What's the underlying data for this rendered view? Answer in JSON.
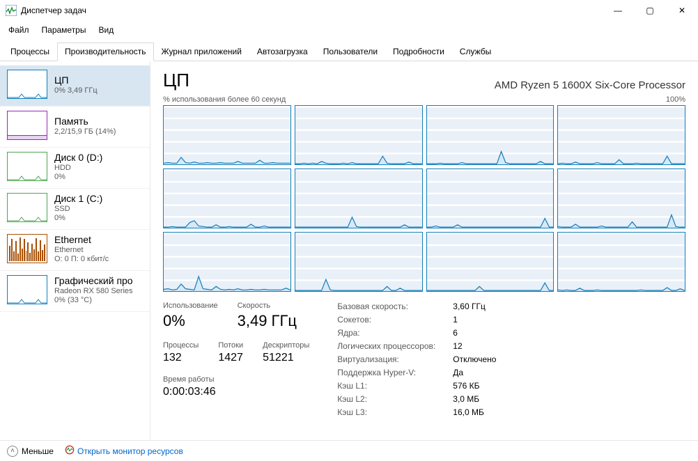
{
  "window": {
    "title": "Диспетчер задач",
    "buttons": {
      "min": "—",
      "max": "▢",
      "close": "✕"
    }
  },
  "menu": [
    "Файл",
    "Параметры",
    "Вид"
  ],
  "tabs": [
    "Процессы",
    "Производительность",
    "Журнал приложений",
    "Автозагрузка",
    "Пользователи",
    "Подробности",
    "Службы"
  ],
  "active_tab_index": 1,
  "sidebar": [
    {
      "kind": "cpu",
      "title": "ЦП",
      "lines": [
        "0% 3,49 ГГц"
      ]
    },
    {
      "kind": "mem",
      "title": "Память",
      "lines": [
        "2,2/15,9 ГБ (14%)"
      ]
    },
    {
      "kind": "disk",
      "title": "Диск 0 (D:)",
      "lines": [
        "HDD",
        "0%"
      ]
    },
    {
      "kind": "disk",
      "title": "Диск 1 (C:)",
      "lines": [
        "SSD",
        "0%"
      ]
    },
    {
      "kind": "net",
      "title": "Ethernet",
      "lines": [
        "Ethernet",
        "О: 0 П: 0 кбит/с"
      ]
    },
    {
      "kind": "gpu",
      "title": "Графический про",
      "lines": [
        "Radeon RX 580 Series",
        "0% (33 °C)"
      ]
    }
  ],
  "selected_sidebar_index": 0,
  "main": {
    "heading": "ЦП",
    "cpu_name": "AMD Ryzen 5 1600X Six-Core Processor",
    "chart_lead": "% использования более 60 секунд",
    "chart_max": "100%",
    "left_metrics": {
      "util_lbl": "Использование",
      "util_val": "0%",
      "speed_lbl": "Скорость",
      "speed_val": "3,49 ГГц",
      "proc_lbl": "Процессы",
      "proc_val": "132",
      "thr_lbl": "Потоки",
      "thr_val": "1427",
      "hnd_lbl": "Дескрипторы",
      "hnd_val": "51221",
      "up_lbl": "Время работы",
      "up_val": "0:00:03:46"
    },
    "right_kv": [
      {
        "k": "Базовая скорость:",
        "v": "3,60 ГГц"
      },
      {
        "k": "Сокетов:",
        "v": "1"
      },
      {
        "k": "Ядра:",
        "v": "6"
      },
      {
        "k": "Логических процессоров:",
        "v": "12"
      },
      {
        "k": "Виртуализация:",
        "v": "Отключено"
      },
      {
        "k": "Поддержка Hyper-V:",
        "v": "Да"
      },
      {
        "k": "Кэш L1:",
        "v": "576 КБ"
      },
      {
        "k": "Кэш L2:",
        "v": "3,0 МБ"
      },
      {
        "k": "Кэш L3:",
        "v": "16,0 МБ"
      }
    ]
  },
  "statusbar": {
    "fewer": "Меньше",
    "open_resmon": "Открыть монитор ресурсов"
  },
  "chart_data": {
    "type": "line",
    "title": "% использования более 60 секунд",
    "ylim": [
      0,
      100
    ],
    "x_seconds": 60,
    "cores": 12,
    "note": "Values are approximate CPU % read from 12 per-core mini charts, left-to-right top-to-bottom. Low idle utilization with intermittent spikes.",
    "series": [
      {
        "name": "Core 1",
        "values": [
          2,
          3,
          2,
          2,
          12,
          3,
          2,
          4,
          2,
          2,
          3,
          2,
          2,
          3,
          2,
          2,
          2,
          5,
          2,
          2,
          2,
          2,
          7,
          2,
          2,
          3,
          2,
          2,
          2,
          2
        ]
      },
      {
        "name": "Core 2",
        "values": [
          1,
          1,
          2,
          1,
          2,
          1,
          5,
          2,
          1,
          1,
          1,
          2,
          1,
          3,
          1,
          1,
          1,
          1,
          1,
          1,
          14,
          2,
          1,
          1,
          1,
          1,
          4,
          1,
          1,
          1
        ]
      },
      {
        "name": "Core 3",
        "values": [
          1,
          1,
          1,
          2,
          1,
          1,
          1,
          1,
          3,
          1,
          1,
          1,
          1,
          1,
          1,
          1,
          1,
          22,
          3,
          1,
          1,
          1,
          1,
          1,
          1,
          1,
          5,
          1,
          1,
          1
        ]
      },
      {
        "name": "Core 4",
        "values": [
          1,
          2,
          1,
          1,
          4,
          1,
          1,
          1,
          1,
          3,
          1,
          1,
          1,
          1,
          8,
          1,
          1,
          1,
          2,
          1,
          1,
          1,
          1,
          1,
          1,
          14,
          1,
          1,
          1,
          1
        ]
      },
      {
        "name": "Core 5",
        "values": [
          1,
          1,
          2,
          1,
          1,
          1,
          9,
          12,
          3,
          2,
          1,
          1,
          5,
          1,
          1,
          2,
          1,
          1,
          1,
          1,
          6,
          1,
          1,
          3,
          1,
          1,
          1,
          1,
          1,
          1
        ]
      },
      {
        "name": "Core 6",
        "values": [
          1,
          1,
          1,
          1,
          1,
          1,
          1,
          1,
          1,
          1,
          1,
          1,
          1,
          18,
          2,
          1,
          1,
          1,
          1,
          1,
          1,
          1,
          1,
          1,
          1,
          5,
          1,
          1,
          1,
          1
        ]
      },
      {
        "name": "Core 7",
        "values": [
          1,
          1,
          3,
          1,
          1,
          1,
          1,
          5,
          1,
          1,
          1,
          1,
          1,
          1,
          1,
          1,
          1,
          1,
          1,
          1,
          1,
          1,
          1,
          1,
          1,
          1,
          1,
          16,
          1,
          1
        ]
      },
      {
        "name": "Core 8",
        "values": [
          2,
          1,
          1,
          1,
          6,
          1,
          1,
          1,
          1,
          1,
          3,
          1,
          1,
          1,
          1,
          1,
          1,
          10,
          1,
          1,
          1,
          1,
          1,
          1,
          1,
          1,
          22,
          2,
          1,
          1
        ]
      },
      {
        "name": "Core 9",
        "values": [
          3,
          4,
          2,
          3,
          12,
          4,
          3,
          2,
          25,
          4,
          3,
          2,
          8,
          3,
          2,
          3,
          2,
          4,
          2,
          2,
          3,
          2,
          2,
          3,
          2,
          2,
          2,
          2,
          5,
          2
        ]
      },
      {
        "name": "Core 10",
        "values": [
          1,
          1,
          1,
          1,
          1,
          1,
          1,
          20,
          2,
          1,
          1,
          1,
          1,
          1,
          1,
          1,
          1,
          1,
          1,
          1,
          1,
          8,
          1,
          1,
          5,
          1,
          1,
          1,
          1,
          1
        ]
      },
      {
        "name": "Core 11",
        "values": [
          1,
          1,
          1,
          1,
          1,
          1,
          1,
          1,
          1,
          1,
          1,
          1,
          8,
          1,
          1,
          1,
          1,
          1,
          1,
          1,
          1,
          1,
          1,
          1,
          1,
          1,
          1,
          14,
          1,
          1
        ]
      },
      {
        "name": "Core 12",
        "values": [
          2,
          1,
          2,
          1,
          1,
          5,
          1,
          1,
          1,
          2,
          1,
          1,
          1,
          1,
          1,
          1,
          1,
          1,
          1,
          2,
          1,
          1,
          1,
          1,
          1,
          6,
          1,
          1,
          4,
          1
        ]
      }
    ]
  }
}
